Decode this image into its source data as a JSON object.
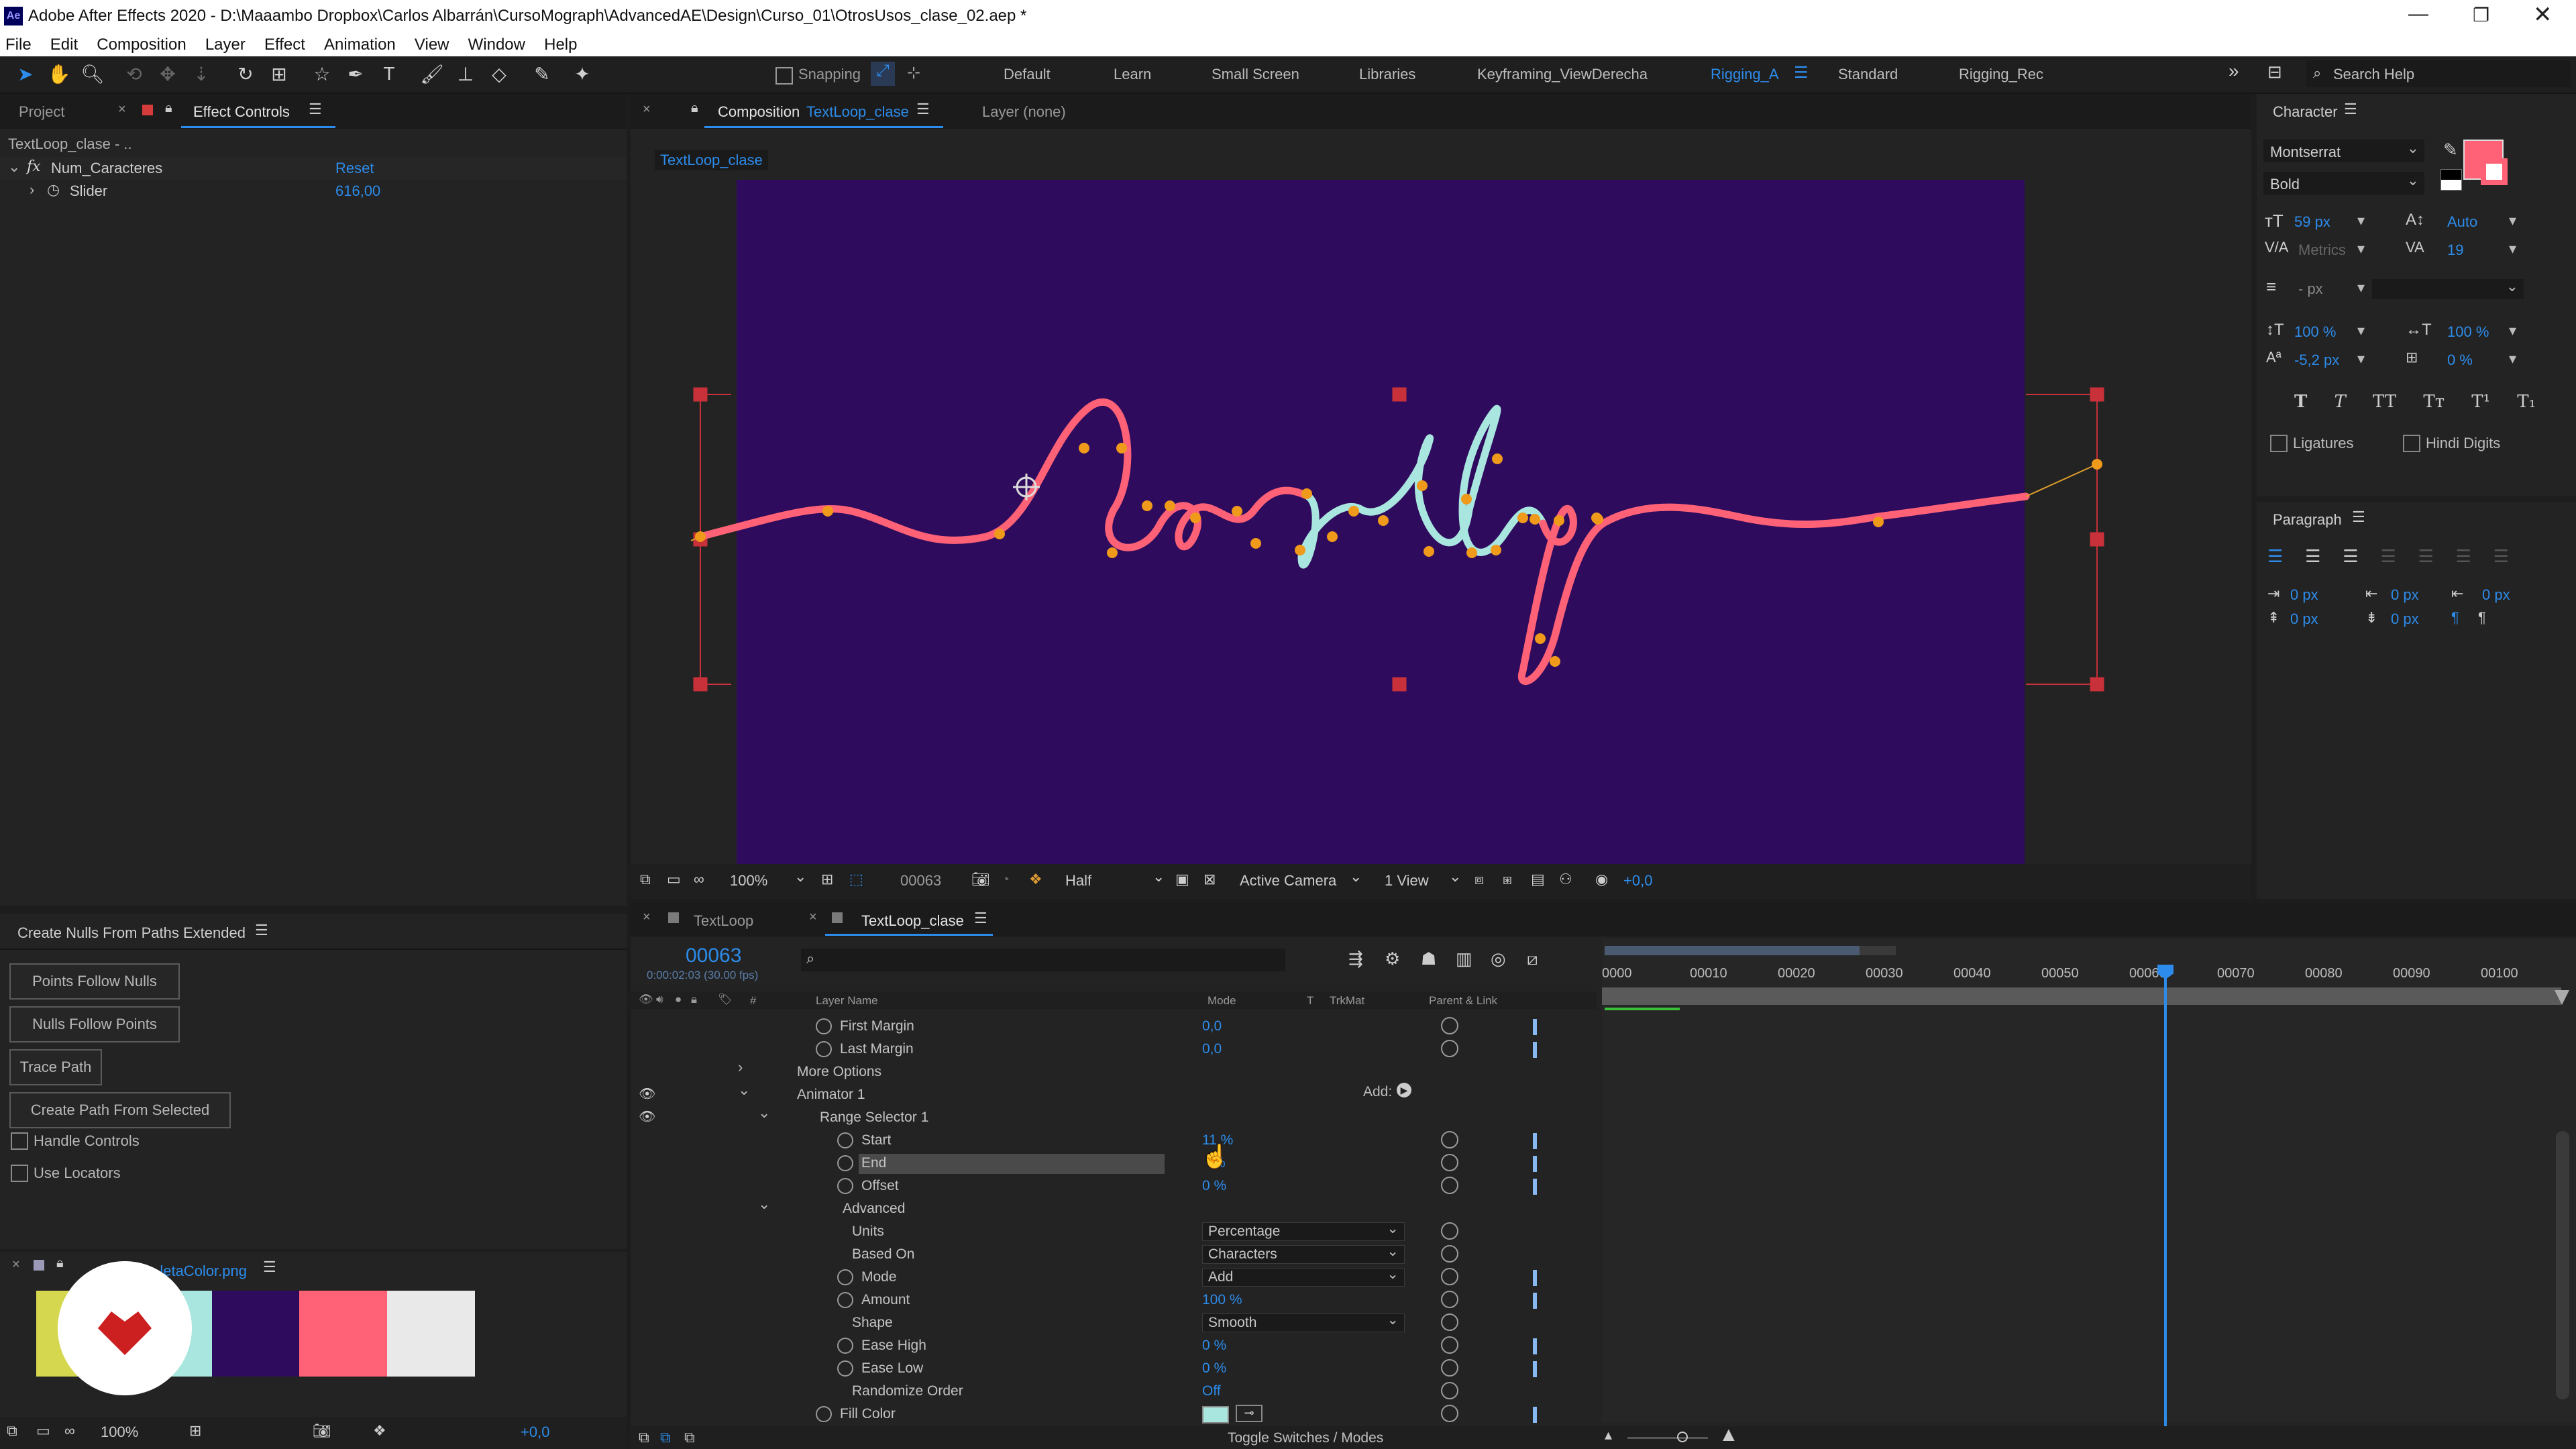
{
  "window": {
    "title": "Adobe After Effects 2020 - D:\\Maaambo Dropbox\\Carlos Albarrán\\CursoMograph\\AdvancedAE\\Design\\Curso_01\\OtrosUsos_clase_02.aep *"
  },
  "menu": [
    "File",
    "Edit",
    "Composition",
    "Layer",
    "Effect",
    "Animation",
    "View",
    "Window",
    "Help"
  ],
  "toolbar": {
    "snapping_label": "Snapping",
    "search_placeholder": "Search Help"
  },
  "workspaces": [
    "Default",
    "Learn",
    "Small Screen",
    "Libraries",
    "Keyframing_ViewDerecha",
    "Rigging_A",
    "Standard",
    "Rigging_Rec"
  ],
  "active_workspace": "Rigging_A",
  "left_panel": {
    "tabs": [
      "Project",
      "Effect Controls"
    ],
    "breadcrumb": "TextLoop_clase - ..",
    "effect_name": "Num_Caracteres",
    "reset_label": "Reset",
    "slider_label": "Slider",
    "slider_value": "616,00"
  },
  "script_panel": {
    "title": "Create Nulls From Paths Extended",
    "buttons": [
      "Points Follow Nulls",
      "Nulls Follow Points",
      "Trace Path",
      "Create Path From Selected"
    ],
    "checkboxes": [
      "Handle Controls",
      "Use Locators"
    ]
  },
  "footage": {
    "name": "...letaColor.png",
    "colors": [
      "#d5d84e",
      "#a8e6df",
      "#2f0b5e",
      "#ff6276",
      "#e9e9e9"
    ],
    "zoom": "100%",
    "exposure": "+0,0"
  },
  "composition": {
    "tab_prefix": "Composition",
    "tab_name": "TextLoop_clase",
    "layer_label": "Layer (none)",
    "breadcrumb": "TextLoop_clase",
    "text": "lovely",
    "bg_color": "#2f0b5e",
    "footer": {
      "zoom": "100%",
      "timecode": "00063",
      "resolution": "Half",
      "camera": "Active Camera",
      "views": "1 View",
      "exposure": "+0,0"
    }
  },
  "character": {
    "title": "Character",
    "font": "Montserrat",
    "style": "Bold",
    "size": "59 px",
    "leading": "Auto",
    "kerning": "Metrics",
    "tracking": "19",
    "stroke": "- px",
    "vscale": "100 %",
    "hscale": "100 %",
    "baseline": "-5,2 px",
    "tsume": "0 %",
    "ligatures": "Ligatures",
    "hindi": "Hindi Digits",
    "fill_color": "#ff6276"
  },
  "paragraph": {
    "title": "Paragraph",
    "indents": [
      "0 px",
      "0 px",
      "0 px",
      "0 px",
      "0 px"
    ]
  },
  "timeline": {
    "tabs": [
      "TextLoop",
      "TextLoop_clase"
    ],
    "timecode": "00063",
    "timecode_sub": "0:00:02:03 (30.00 fps)",
    "columns": [
      "Layer Name",
      "Mode",
      "T",
      "TrkMat",
      "Parent & Link"
    ],
    "ruler": [
      "0000",
      "00010",
      "00020",
      "00030",
      "00040",
      "00050",
      "00060",
      "00070",
      "00080",
      "00090",
      "00100"
    ],
    "add_label": "Add:",
    "rows": [
      {
        "indent": 2,
        "label": "First Margin",
        "value": "0,0",
        "stopwatch": true
      },
      {
        "indent": 2,
        "label": "Last Margin",
        "value": "0,0",
        "stopwatch": true
      },
      {
        "indent": 1,
        "label": "More Options",
        "twirl": "right"
      },
      {
        "indent": 1,
        "label": "Animator 1",
        "twirl": "down",
        "eye": true
      },
      {
        "indent": 2,
        "label": "Range Selector 1",
        "twirl": "down",
        "eye": true
      },
      {
        "indent": 3,
        "label": "Start",
        "value": "11 %",
        "stopwatch": true
      },
      {
        "indent": 3,
        "label": "End",
        "value": "% ",
        "stopwatch": true,
        "selected": true
      },
      {
        "indent": 3,
        "label": "Offset",
        "value": "0 %",
        "stopwatch": true
      },
      {
        "indent": 2,
        "label": "Advanced",
        "twirl": "down"
      },
      {
        "indent": 3,
        "label": "Units",
        "dropdown": "Percentage"
      },
      {
        "indent": 3,
        "label": "Based On",
        "dropdown": "Characters"
      },
      {
        "indent": 3,
        "label": "Mode",
        "dropdown": "Add",
        "stopwatch": true
      },
      {
        "indent": 3,
        "label": "Amount",
        "value": "100 %",
        "stopwatch": true
      },
      {
        "indent": 3,
        "label": "Shape",
        "dropdown": "Smooth"
      },
      {
        "indent": 3,
        "label": "Ease High",
        "value": "0 %",
        "stopwatch": true
      },
      {
        "indent": 3,
        "label": "Ease Low",
        "value": "0 %",
        "stopwatch": true
      },
      {
        "indent": 3,
        "label": "Randomize Order",
        "value": "Off"
      },
      {
        "indent": 1,
        "label": "Fill Color",
        "stopwatch": true,
        "swatch": "#a8e6df"
      }
    ],
    "footer_label": "Toggle Switches / Modes"
  }
}
